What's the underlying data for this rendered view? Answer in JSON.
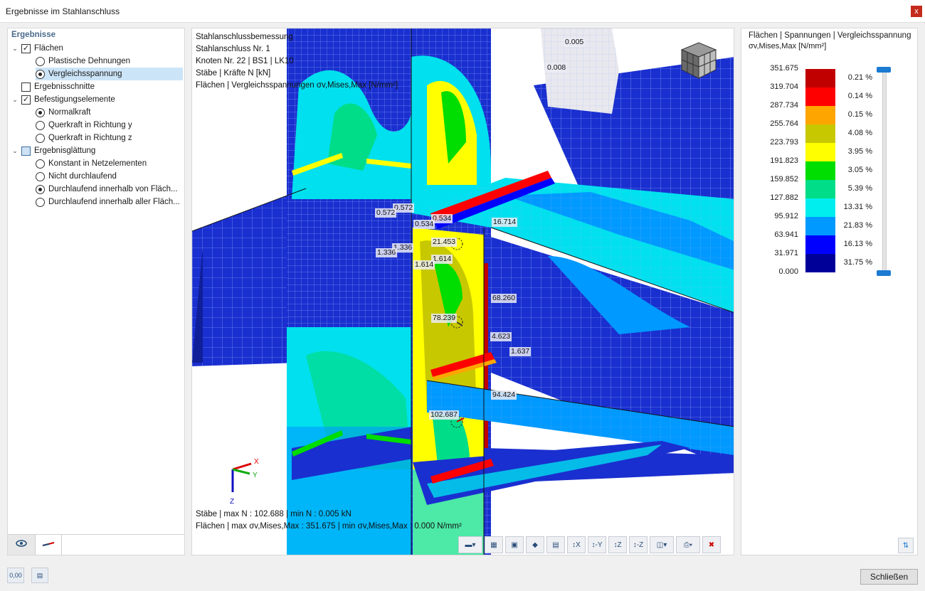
{
  "window": {
    "title": "Ergebnisse im Stahlanschluss",
    "close_glyph": "x"
  },
  "nav": {
    "header": "Ergebnisse",
    "items": [
      {
        "label": "Flächen",
        "kind": "check",
        "state": "checked",
        "chevron": "open"
      },
      {
        "label": "Plastische Dehnungen",
        "kind": "radio",
        "state": "off"
      },
      {
        "label": "Vergleichsspannung",
        "kind": "radio",
        "state": "on",
        "selected": true
      },
      {
        "label": "Ergebnisschnitte",
        "kind": "check",
        "state": "unchecked"
      },
      {
        "label": "Befestigungselemente",
        "kind": "check",
        "state": "checked",
        "chevron": "open"
      },
      {
        "label": "Normalkraft",
        "kind": "radio",
        "state": "on"
      },
      {
        "label": "Querkraft in Richtung y",
        "kind": "radio",
        "state": "off"
      },
      {
        "label": "Querkraft in Richtung z",
        "kind": "radio",
        "state": "off"
      },
      {
        "label": "Ergebnisglättung",
        "kind": "check",
        "state": "partial",
        "chevron": "open"
      },
      {
        "label": "Konstant in Netzelementen",
        "kind": "radio",
        "state": "off"
      },
      {
        "label": "Nicht durchlaufend",
        "kind": "radio",
        "state": "off"
      },
      {
        "label": "Durchlaufend innerhalb von Fläch...",
        "kind": "radio",
        "state": "on"
      },
      {
        "label": "Durchlaufend innerhalb aller Fläch...",
        "kind": "radio",
        "state": "off"
      }
    ],
    "tabs": [
      "eye-icon",
      "members-icon"
    ]
  },
  "viewport": {
    "info": [
      "Stahlanschlussbemessung",
      "Stahlanschluss Nr. 1",
      "Knoten Nr. 22 | BS1 | LK10",
      "Stäbe | Kräfte N [kN]",
      "Flächen | Vergleichsspannungen σv,Mises,Max [N/mm²]"
    ],
    "bottom": [
      "Stäbe | max N : 102.688 | min N : 0.005 kN",
      "Flächen | max σv,Mises,Max : 351.675 | min σv,Mises,Max : 0.000 N/mm²"
    ],
    "value_labels": [
      "0.005",
      "0.008",
      "0.572",
      "0.572",
      "0.534",
      "0.534",
      "16.714",
      "1.336",
      "1.336",
      "21.453",
      "1.614",
      "1.614",
      "68.260",
      "78.239",
      "4.623",
      "1.637",
      "94.424",
      "102.687"
    ],
    "axes": {
      "x": "X",
      "y": "Y",
      "z": "Z"
    },
    "toolbar": [
      "display-icon",
      "grid-icon",
      "model-icon",
      "render-icon",
      "results-icon",
      "view-x-icon",
      "view-minus-y-icon",
      "view-z-icon",
      "view-minus-z-icon",
      "iso-view-icon",
      "print-icon",
      "reset-icon"
    ]
  },
  "legend": {
    "title": "Flächen | Spannungen | Vergleichsspannung",
    "subtitle": "σv,Mises,Max [N/mm²]",
    "values": [
      "351.675",
      "319.704",
      "287.734",
      "255.764",
      "223.793",
      "191.823",
      "159.852",
      "127.882",
      "95.912",
      "63.941",
      "31.971",
      "0.000"
    ],
    "bands": [
      {
        "color": "#c00000",
        "pct": "0.21 %"
      },
      {
        "color": "#ff0000",
        "pct": "0.14 %"
      },
      {
        "color": "#ffa500",
        "pct": "0.15 %"
      },
      {
        "color": "#c8c800",
        "pct": "4.08 %"
      },
      {
        "color": "#ffff00",
        "pct": "3.95 %"
      },
      {
        "color": "#00dd00",
        "pct": "3.05 %"
      },
      {
        "color": "#00dd88",
        "pct": "5.39 %"
      },
      {
        "color": "#00eeee",
        "pct": "13.31 %"
      },
      {
        "color": "#0099ff",
        "pct": "21.83 %"
      },
      {
        "color": "#0000ff",
        "pct": "16.13 %"
      },
      {
        "color": "#000099",
        "pct": "31.75 %"
      }
    ]
  },
  "footer": {
    "close_label": "Schließen",
    "units_icon": "0,00"
  }
}
